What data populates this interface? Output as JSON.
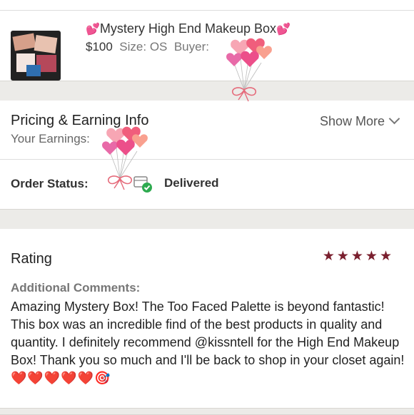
{
  "item": {
    "title_emoji": "💕",
    "title": "Mystery High End Makeup Box",
    "price": "$100",
    "size_label": "Size:",
    "size_value": "OS",
    "buyer_label": "Buyer:"
  },
  "pricing": {
    "title": "Pricing & Earning Info",
    "earnings_label": "Your Earnings:",
    "show_more": "Show More"
  },
  "order": {
    "label": "Order Status:",
    "status": "Delivered"
  },
  "rating": {
    "title": "Rating",
    "stars": "★★★★★",
    "additional_label": "Additional Comments:",
    "comment": "Amazing Mystery Box! The Too Faced Palette is beyond fantastic! This box was an incredible find of the best products in quality and quantity. I definitely recommend @kissntell for the High End Makeup Box! Thank you so much and I'll be back to shop in your closet again!",
    "comment_emojis": "❤️❤️❤️❤️❤️🎯"
  },
  "colors": {
    "star": "#7a1f2e",
    "delivered_check": "#2daa4f",
    "band": "#ecebe8"
  },
  "stickers": {
    "balloon_icon": "heart-balloons-icon"
  }
}
